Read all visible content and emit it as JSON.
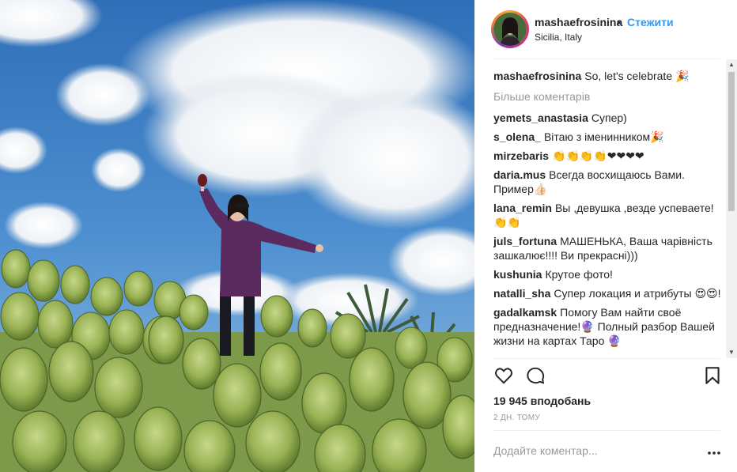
{
  "post": {
    "image_alt": "Woman in purple sweater among cactus field under cloudy sky"
  },
  "header": {
    "username": "mashaefrosinina",
    "separator": "•",
    "follow_label": "Стежити",
    "location": "Sicilia, Italy"
  },
  "caption": {
    "username": "mashaefrosinina",
    "text": "So, let's celebrate 🎉"
  },
  "comments": {
    "more_label": "Більше коментарів",
    "items": [
      {
        "username": "yemets_anastasia",
        "text": "Супер)"
      },
      {
        "username": "s_olena_",
        "text": "Вітаю з іменинником🎉"
      },
      {
        "username": "mirzebaris",
        "text": "👏👏👏👏❤❤❤❤"
      },
      {
        "username": "daria.mus",
        "text": "Всегда восхищаюсь Вами. Пример👍🏻"
      },
      {
        "username": "lana_remin",
        "text": "Вы ,девушка ,везде успеваете! 👏👏"
      },
      {
        "username": "juls_fortuna",
        "text": "МАШЕНЬКА, Ваша чарівність зашкалює!!!! Ви прекрасні)))"
      },
      {
        "username": "kushunia",
        "text": "Крутое фото!"
      },
      {
        "username": "natalli_sha",
        "text": "Супер локация и атрибуты 😍😍!"
      },
      {
        "username": "gadalkamsk",
        "text": "Помогу Вам найти своё предназначение!🔮 Полный разбор Вашей жизни на картах Таро 🔮"
      }
    ]
  },
  "actions": {
    "like_icon": "heart-outline-icon",
    "comment_icon": "speech-bubble-icon",
    "save_icon": "bookmark-icon"
  },
  "likes_label": "19 945 вподобань",
  "timestamp": "2 ДН. ТОМУ",
  "add_comment_placeholder": "Додайте коментар...",
  "more_options_icon": "ellipsis-icon",
  "colors": {
    "link": "#3897f0",
    "text": "#262626",
    "muted": "#999999",
    "divider": "#efefef"
  }
}
